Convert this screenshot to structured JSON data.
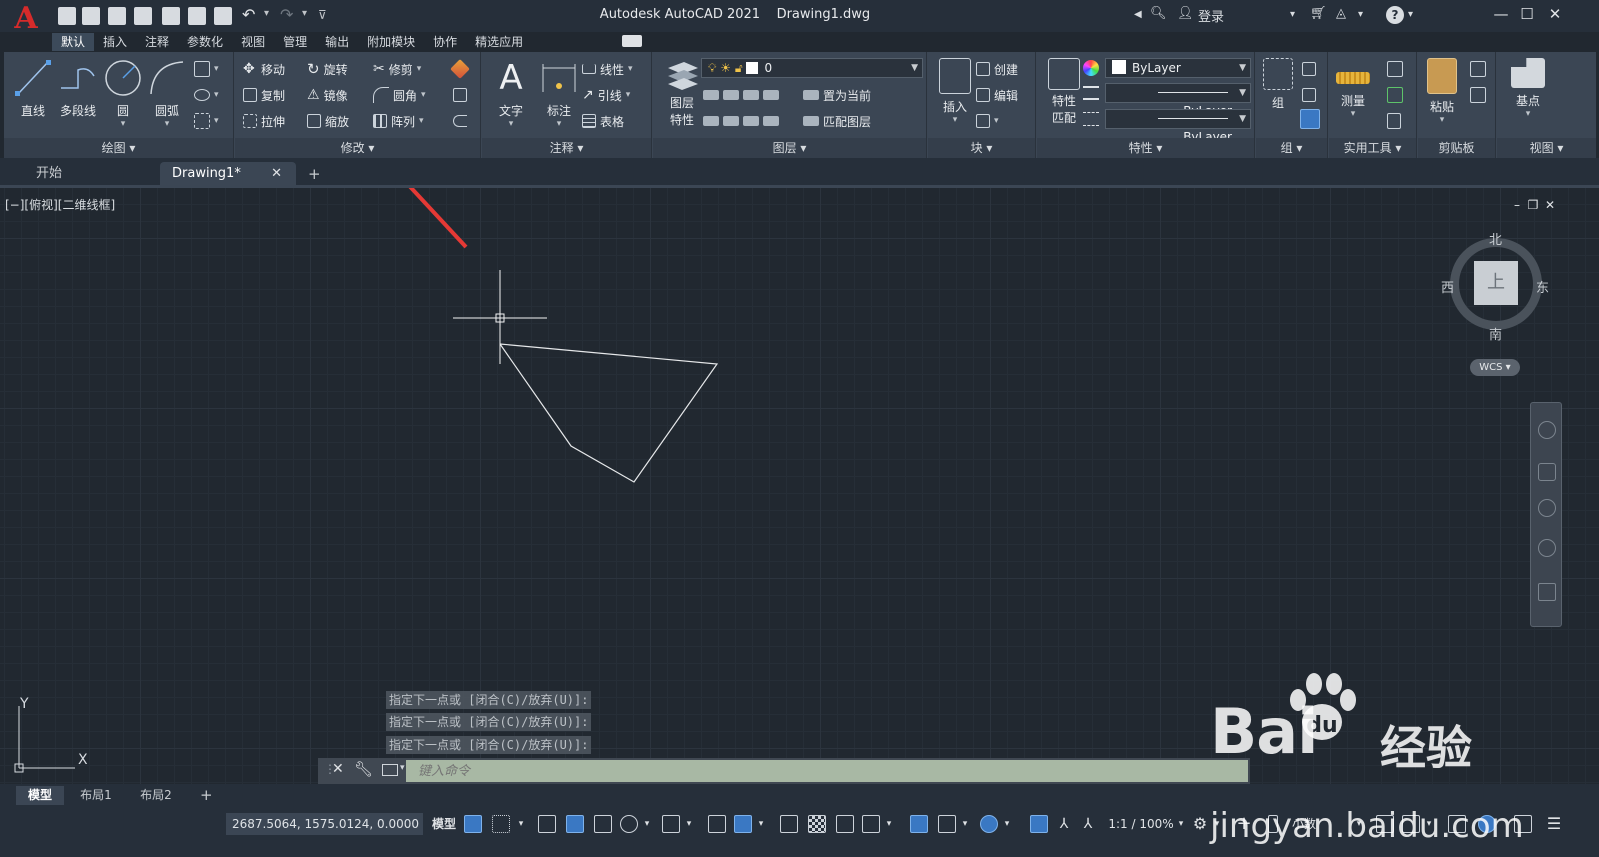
{
  "titlebar": {
    "app_title": "Autodesk AutoCAD 2021",
    "file_name": "Drawing1.dwg",
    "sign_in": "登录",
    "logo_letter": "A",
    "help": "?"
  },
  "ribbon_tabs": [
    "默认",
    "插入",
    "注释",
    "参数化",
    "视图",
    "管理",
    "输出",
    "附加模块",
    "协作",
    "精选应用"
  ],
  "panels": {
    "draw": {
      "footer": "绘图 ▾",
      "line": "直线",
      "polyline": "多段线",
      "circle": "圆",
      "arc": "圆弧"
    },
    "modify": {
      "footer": "修改 ▾",
      "move": "移动",
      "rotate": "旋转",
      "trim": "修剪",
      "copy": "复制",
      "mirror": "镜像",
      "fillet": "圆角",
      "stretch": "拉伸",
      "scale": "缩放",
      "array": "阵列"
    },
    "annotation": {
      "footer": "注释 ▾",
      "text": "文字",
      "dimension": "标注",
      "linear": "线性",
      "leader": "引线",
      "table": "表格"
    },
    "layers": {
      "footer": "图层 ▾",
      "layer_properties_1": "图层",
      "layer_properties_2": "特性",
      "current_layer": "0",
      "set_current": "置为当前",
      "match_layer": "匹配图层"
    },
    "block": {
      "footer": "块 ▾",
      "insert": "插入",
      "create": "创建",
      "edit": "编辑"
    },
    "properties": {
      "footer": "特性 ▾",
      "match_1": "特性",
      "match_2": "匹配",
      "color": "ByLayer",
      "linetype": "ByLayer",
      "lineweight": "ByLayer"
    },
    "groups": {
      "footer": "组 ▾",
      "group": "组"
    },
    "utilities": {
      "footer": "实用工具 ▾",
      "measure": "测量"
    },
    "clipboard": {
      "footer": "剪贴板",
      "paste": "粘贴"
    },
    "view": {
      "footer": "视图 ▾",
      "base": "基点"
    }
  },
  "doc_tabs": {
    "start": "开始",
    "drawing": "Drawing1*",
    "close": "✕",
    "add": "+"
  },
  "viewport": {
    "label": "[−][俯视][二维线框]",
    "viewcube": {
      "north": "北",
      "south": "南",
      "east": "东",
      "west": "西",
      "face": "上",
      "wcs": "WCS ▾"
    },
    "ucs_y": "Y",
    "ucs_x": "X"
  },
  "command_history": [
    "指定下一点或 [闭合(C)/放弃(U)]:",
    "指定下一点或 [闭合(C)/放弃(U)]:",
    "指定下一点或 [闭合(C)/放弃(U)]:"
  ],
  "command_input": {
    "placeholder": "键入命令"
  },
  "layout_tabs": [
    "模型",
    "布局1",
    "布局2"
  ],
  "statusbar": {
    "coords": "2687.5064, 1575.0124, 0.0000",
    "model": "模型",
    "scale": "1:1 / 100%",
    "units": "小数"
  },
  "watermark": {
    "brand": "Bai",
    "brand2": "经验",
    "url": "jingyan.baidu.com"
  },
  "colors": {
    "accent_arrow": "#e53935",
    "active_toggle": "#3a78c3"
  }
}
